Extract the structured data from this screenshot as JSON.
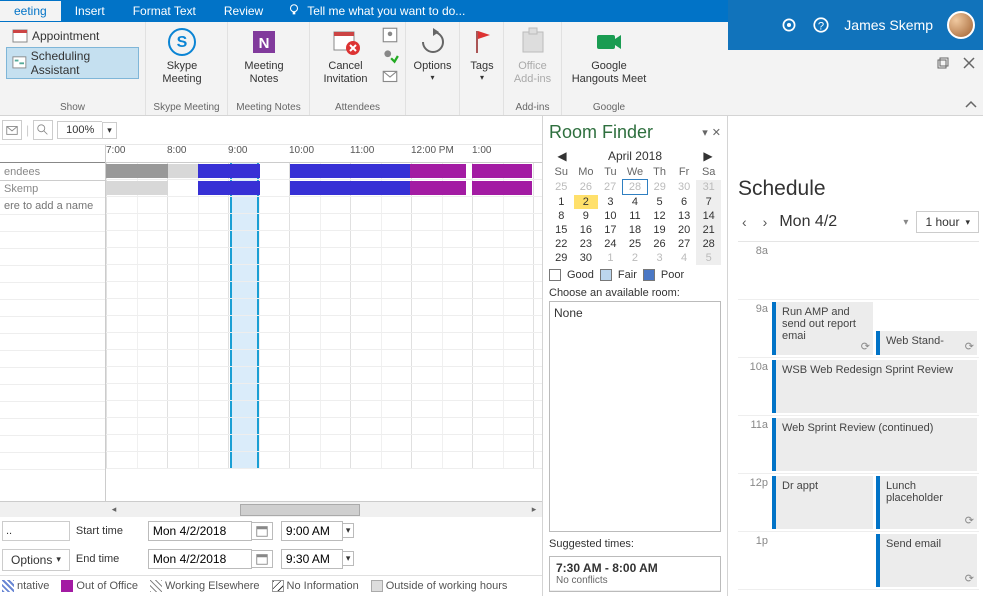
{
  "ribbon": {
    "tabs": [
      "eeting",
      "Insert",
      "Format Text",
      "Review"
    ],
    "tell_me": "Tell me what you want to do...",
    "show": {
      "label": "Show",
      "appointment": "Appointment",
      "scheduling": "Scheduling Assistant"
    },
    "skype": {
      "label": "Skype Meeting",
      "btn": "Skype\nMeeting"
    },
    "notes": {
      "label": "Meeting Notes",
      "btn": "Meeting\nNotes"
    },
    "attendees": {
      "label": "Attendees",
      "cancel": "Cancel\nInvitation"
    },
    "options": {
      "label": "",
      "btn": "Options"
    },
    "tags": {
      "label": "",
      "btn": "Tags"
    },
    "addins": {
      "label": "Add-ins",
      "btn": "Office\nAdd-ins"
    },
    "google": {
      "label": "Google",
      "btn": "Google\nHangouts Meet"
    }
  },
  "timeline": {
    "zoom": "100%",
    "hours": [
      "7:00",
      "8:00",
      "9:00",
      "10:00",
      "11:00",
      "12:00 PM",
      "1:00"
    ],
    "attendees_header": "endees",
    "row1": "Skemp",
    "add_placeholder": "ere to add a name",
    "options_btn": "Options",
    "start_label": "Start time",
    "end_label": "End time",
    "start_date": "Mon 4/2/2018",
    "end_date": "Mon 4/2/2018",
    "start_time": "9:00 AM",
    "end_time": "9:30 AM"
  },
  "legend": {
    "tentative": "ntative",
    "ooo": "Out of Office",
    "elsewhere": "Working Elsewhere",
    "noinfo": "No Information",
    "outside": "Outside of working hours"
  },
  "room_finder": {
    "title": "Room Finder",
    "month": "April 2018",
    "dow": [
      "Su",
      "Mo",
      "Tu",
      "We",
      "Th",
      "Fr",
      "Sa"
    ],
    "weeks": [
      [
        {
          "d": 25,
          "dim": true
        },
        {
          "d": 26,
          "dim": true
        },
        {
          "d": 27,
          "dim": true
        },
        {
          "d": 28,
          "dim": true,
          "today": true
        },
        {
          "d": 29,
          "dim": true
        },
        {
          "d": 30,
          "dim": true
        },
        {
          "d": 31,
          "dim": true,
          "gray": true
        }
      ],
      [
        {
          "d": 1
        },
        {
          "d": 2,
          "sel": true
        },
        {
          "d": 3
        },
        {
          "d": 4
        },
        {
          "d": 5
        },
        {
          "d": 6
        },
        {
          "d": 7,
          "gray": true
        }
      ],
      [
        {
          "d": 8
        },
        {
          "d": 9
        },
        {
          "d": 10
        },
        {
          "d": 11
        },
        {
          "d": 12
        },
        {
          "d": 13
        },
        {
          "d": 14,
          "gray": true
        }
      ],
      [
        {
          "d": 15
        },
        {
          "d": 16
        },
        {
          "d": 17
        },
        {
          "d": 18
        },
        {
          "d": 19
        },
        {
          "d": 20
        },
        {
          "d": 21,
          "gray": true
        }
      ],
      [
        {
          "d": 22
        },
        {
          "d": 23
        },
        {
          "d": 24
        },
        {
          "d": 25
        },
        {
          "d": 26
        },
        {
          "d": 27
        },
        {
          "d": 28,
          "gray": true
        }
      ],
      [
        {
          "d": 29
        },
        {
          "d": 30
        },
        {
          "d": 1,
          "dim": true
        },
        {
          "d": 2,
          "dim": true
        },
        {
          "d": 3,
          "dim": true
        },
        {
          "d": 4,
          "dim": true
        },
        {
          "d": 5,
          "dim": true,
          "gray": true
        }
      ]
    ],
    "good": "Good",
    "fair": "Fair",
    "poor": "Poor",
    "choose_label": "Choose an available room:",
    "room_list": "None",
    "suggested_label": "Suggested times:",
    "sugg_time": "7:30 AM - 8:00 AM",
    "sugg_conf": "No conflicts"
  },
  "schedule": {
    "user": "James Skemp",
    "title": "Schedule",
    "date": "Mon 4/2",
    "range": "1 hour",
    "rows": [
      {
        "time": "8a",
        "events": []
      },
      {
        "time": "9a",
        "events": [
          {
            "text": "Run AMP and send out report emai",
            "recur": true
          },
          {
            "text": "Web Stand-",
            "recur": true,
            "half": true
          }
        ]
      },
      {
        "time": "10a",
        "events": [
          {
            "text": "WSB Web Redesign Sprint Review"
          }
        ]
      },
      {
        "time": "11a",
        "events": [
          {
            "text": "Web Sprint Review (continued)"
          }
        ]
      },
      {
        "time": "12p",
        "events": [
          {
            "text": "Dr appt"
          },
          {
            "text": "Lunch placeholder",
            "recur": true
          }
        ]
      },
      {
        "time": "1p",
        "events": [
          {
            "text": "",
            "spacer": true
          },
          {
            "text": "Send email",
            "recur": true
          }
        ]
      }
    ]
  },
  "colors": {
    "accent": "#0173c7",
    "purple": "#a31ba3",
    "blue": "#3730d5"
  }
}
